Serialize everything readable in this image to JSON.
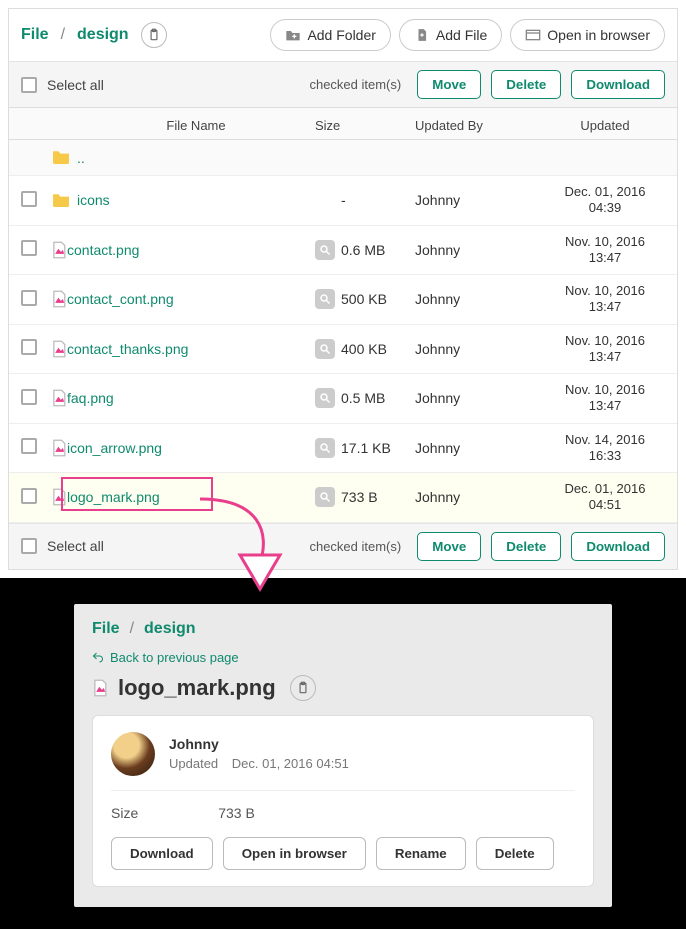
{
  "breadcrumb": {
    "root": "File",
    "current": "design"
  },
  "toolbar": {
    "add_folder": "Add Folder",
    "add_file": "Add File",
    "open_browser": "Open in browser"
  },
  "list_actions": {
    "select_all": "Select all",
    "checked_items": "checked item(s)",
    "move": "Move",
    "delete": "Delete",
    "download": "Download"
  },
  "columns": {
    "name": "File Name",
    "size": "Size",
    "updated_by": "Updated By",
    "updated": "Updated"
  },
  "up_label": "..",
  "rows": [
    {
      "type": "folder",
      "name": "icons",
      "size": "-",
      "by": "Johnny",
      "date1": "Dec. 01, 2016",
      "date2": "04:39"
    },
    {
      "type": "file",
      "name": "contact.png",
      "size": "0.6 MB",
      "by": "Johnny",
      "date1": "Nov. 10, 2016",
      "date2": "13:47"
    },
    {
      "type": "file",
      "name": "contact_cont.png",
      "size": "500 KB",
      "by": "Johnny",
      "date1": "Nov. 10, 2016",
      "date2": "13:47"
    },
    {
      "type": "file",
      "name": "contact_thanks.png",
      "size": "400 KB",
      "by": "Johnny",
      "date1": "Nov. 10, 2016",
      "date2": "13:47"
    },
    {
      "type": "file",
      "name": "faq.png",
      "size": "0.5 MB",
      "by": "Johnny",
      "date1": "Nov. 10, 2016",
      "date2": "13:47"
    },
    {
      "type": "file",
      "name": "icon_arrow.png",
      "size": "17.1 KB",
      "by": "Johnny",
      "date1": "Nov. 14, 2016",
      "date2": "16:33"
    },
    {
      "type": "file",
      "name": "logo_mark.png",
      "size": "733 B",
      "by": "Johnny",
      "date1": "Dec. 01, 2016",
      "date2": "04:51",
      "highlight": true
    }
  ],
  "detail": {
    "breadcrumb": {
      "root": "File",
      "current": "design"
    },
    "back": "Back to previous page",
    "filename": "logo_mark.png",
    "owner": "Johnny",
    "updated_label": "Updated",
    "updated_value": "Dec. 01, 2016 04:51",
    "size_label": "Size",
    "size_value": "733 B",
    "buttons": {
      "download": "Download",
      "open": "Open in browser",
      "rename": "Rename",
      "delete": "Delete"
    }
  }
}
